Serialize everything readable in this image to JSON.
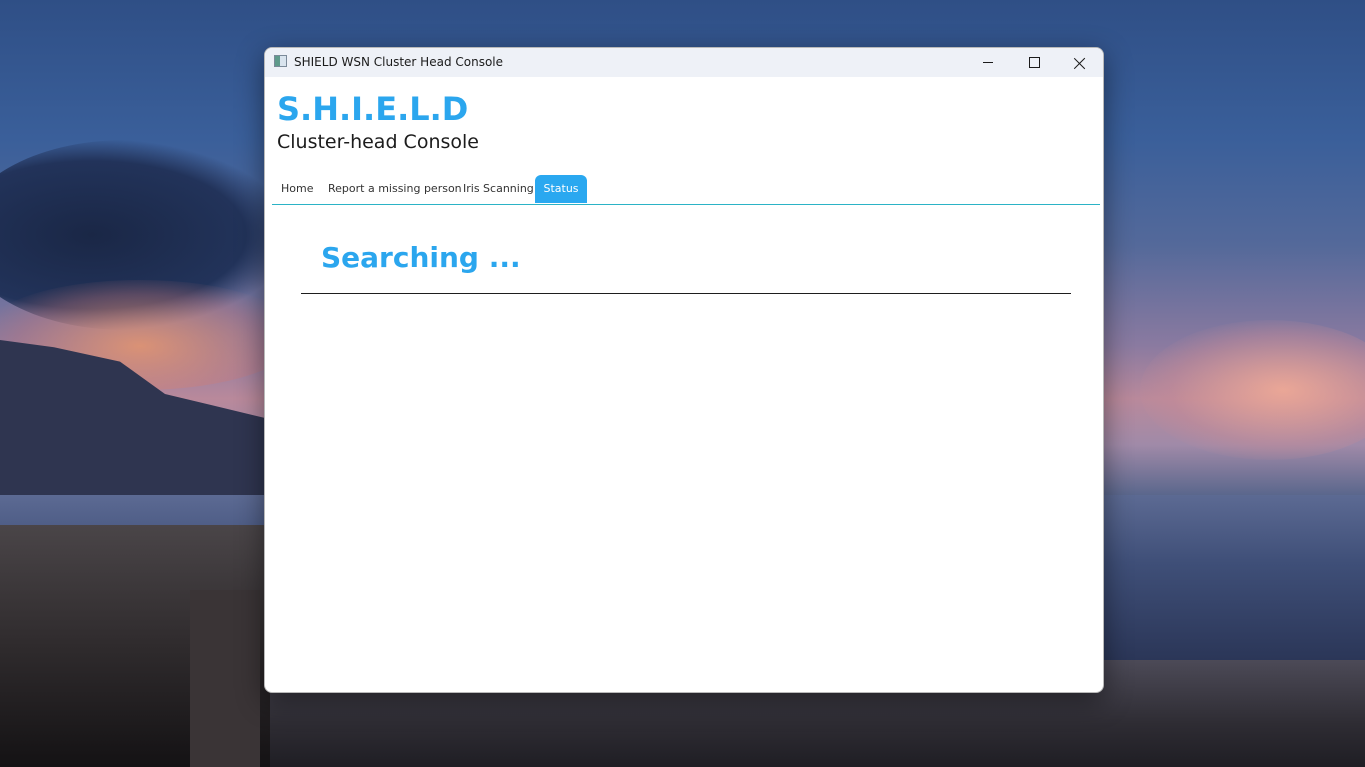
{
  "window": {
    "title": "SHIELD WSN Cluster Head Console"
  },
  "header": {
    "brand": "S.H.I.E.L.D",
    "subtitle": "Cluster-head Console"
  },
  "tabs": [
    {
      "label": "Home",
      "active": false
    },
    {
      "label": "Report a missing person",
      "active": false
    },
    {
      "label": "Iris Scanning",
      "active": false
    },
    {
      "label": "Status",
      "active": true
    }
  ],
  "status": {
    "heading": "Searching ..."
  },
  "colors": {
    "accent": "#2ba6ee",
    "active_tab_bg": "#2aa8f0",
    "tab_underline": "#2bb3c6"
  },
  "icons": {
    "app": "app-window-icon",
    "minimize": "minimize-icon",
    "maximize": "maximize-icon",
    "close": "close-icon"
  }
}
